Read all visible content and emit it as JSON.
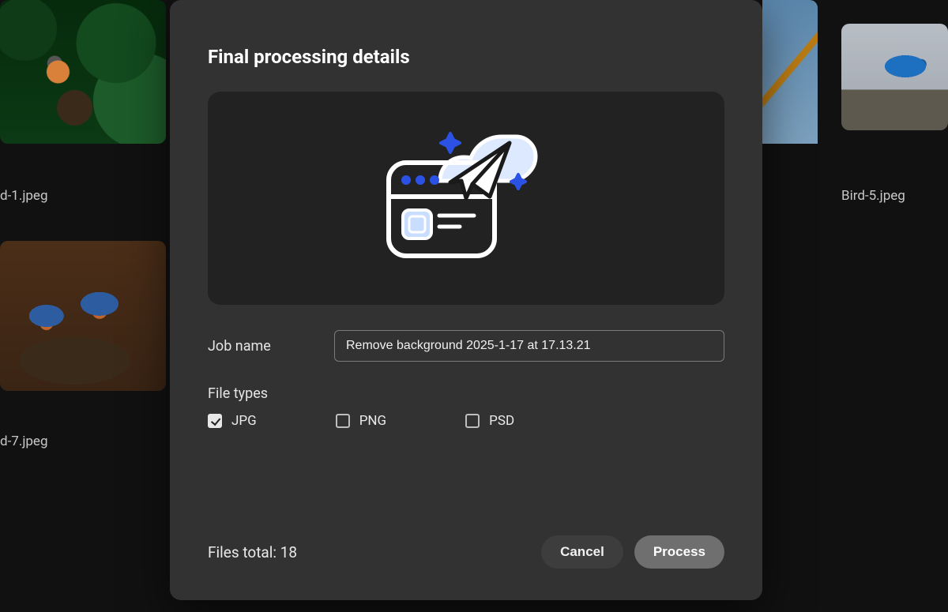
{
  "gallery": {
    "items": [
      {
        "label": "d-1.jpeg"
      },
      {
        "label": "d-7.jpeg"
      },
      {
        "label": "Bird-5.jpeg"
      }
    ]
  },
  "modal": {
    "title": "Final processing details",
    "job_name_label": "Job name",
    "job_name_value": "Remove background 2025-1-17 at 17.13.21",
    "file_types_label": "File types",
    "file_types": [
      {
        "label": "JPG",
        "checked": true
      },
      {
        "label": "PNG",
        "checked": false
      },
      {
        "label": "PSD",
        "checked": false
      }
    ],
    "files_total_label": "Files total: 18",
    "files_total_count": 18,
    "cancel_label": "Cancel",
    "process_label": "Process"
  }
}
